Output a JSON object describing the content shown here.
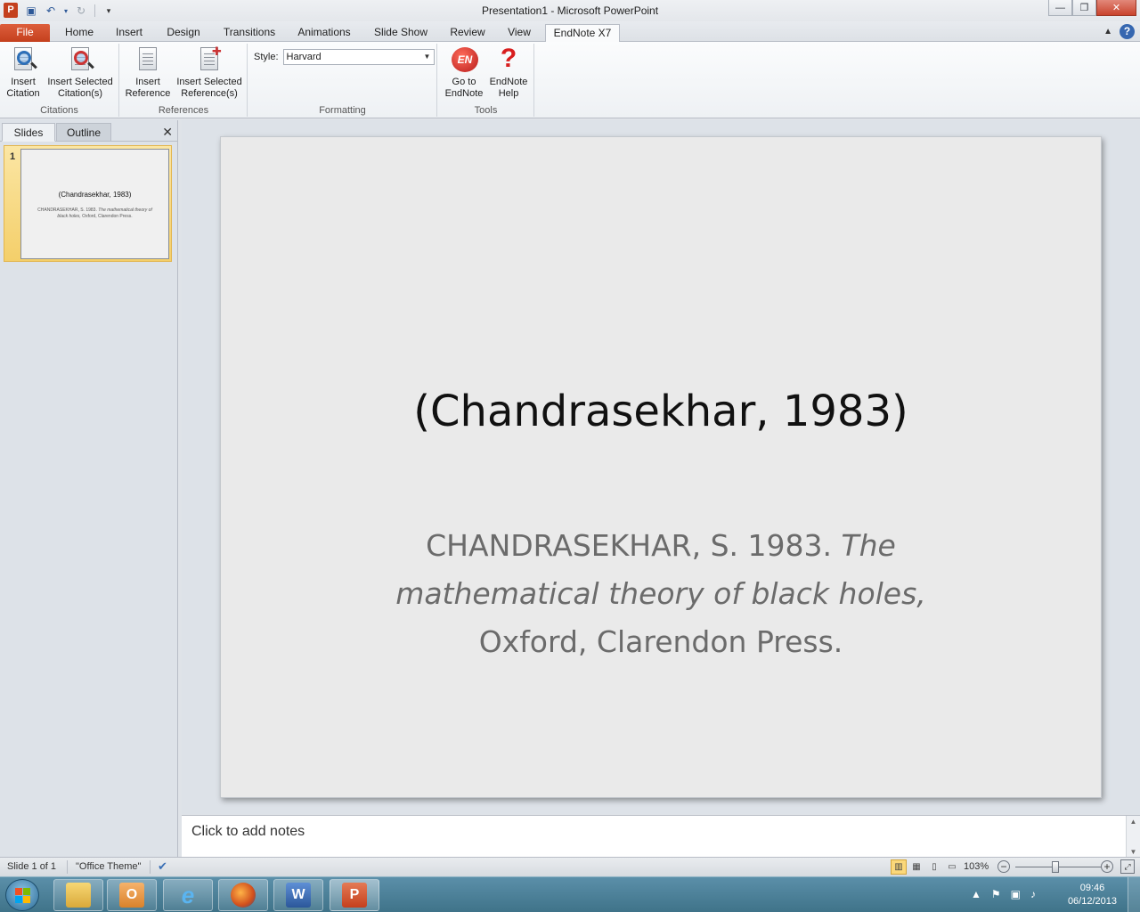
{
  "window": {
    "title": "Presentation1  -  Microsoft PowerPoint",
    "app_icon": "P"
  },
  "tabs": [
    {
      "label": "File"
    },
    {
      "label": "Home"
    },
    {
      "label": "Insert"
    },
    {
      "label": "Design"
    },
    {
      "label": "Transitions"
    },
    {
      "label": "Animations"
    },
    {
      "label": "Slide Show"
    },
    {
      "label": "Review"
    },
    {
      "label": "View"
    },
    {
      "label": "EndNote X7"
    }
  ],
  "ribbon": {
    "citations": {
      "label": "Citations",
      "insert_citation": [
        "Insert",
        "Citation"
      ],
      "insert_selected_citations": [
        "Insert Selected",
        "Citation(s)"
      ]
    },
    "references": {
      "label": "References",
      "insert_reference": [
        "Insert",
        "Reference"
      ],
      "insert_selected_references": [
        "Insert Selected",
        "Reference(s)"
      ]
    },
    "formatting": {
      "label": "Formatting",
      "style_label": "Style:",
      "style_value": "Harvard"
    },
    "tools": {
      "label": "Tools",
      "go_to_endnote": [
        "Go to",
        "EndNote"
      ],
      "endnote_help": [
        "EndNote",
        "Help"
      ],
      "en_logo": "EN"
    }
  },
  "left_pane": {
    "tab_slides": "Slides",
    "tab_outline": "Outline",
    "close": "✕",
    "slide_number": "1",
    "thumb_title": "(Chandrasekhar, 1983)",
    "thumb_body_plain": "CHANDRASEKHAR, S. 1983. ",
    "thumb_body_italic": "The mathematical theory of black holes,",
    "thumb_body_end": " Oxford, Clarendon Press."
  },
  "slide": {
    "title": "(Chandrasekhar, 1983)",
    "body_plain": "CHANDRASEKHAR, S. 1983. ",
    "body_italic": "The mathematical theory of black holes,",
    "body_end": " Oxford, Clarendon Press."
  },
  "notes": {
    "placeholder": "Click to add notes"
  },
  "status": {
    "slide_info": "Slide 1 of 1",
    "theme": "\"Office Theme\"",
    "zoom": "103%",
    "zoom_level_percent": 103
  },
  "taskbar": {
    "time": "09:46",
    "date": "06/12/2013"
  }
}
